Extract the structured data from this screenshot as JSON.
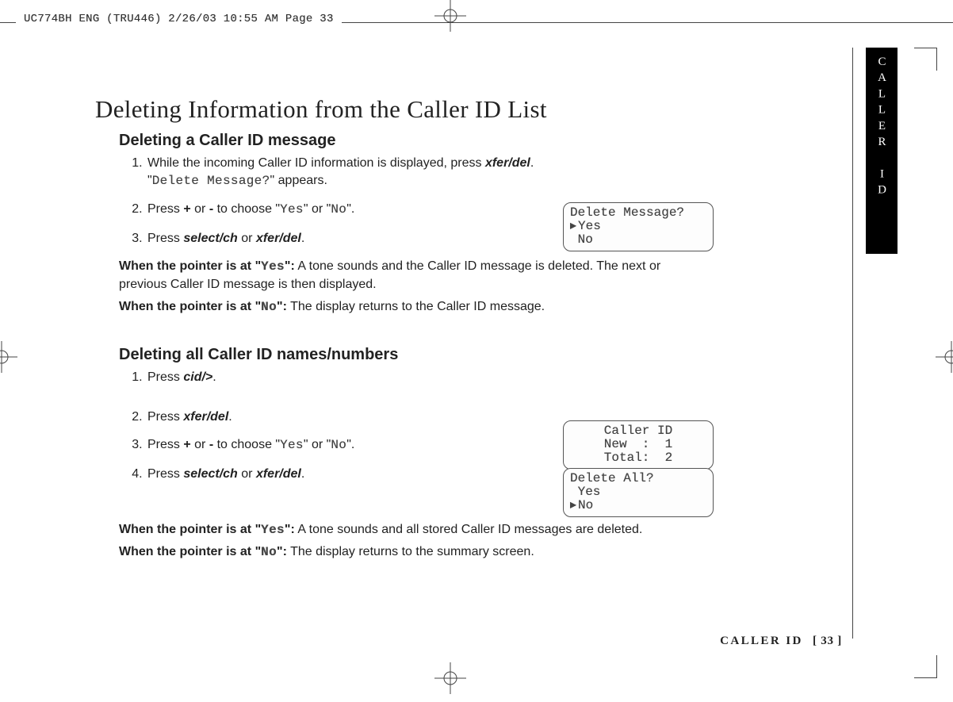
{
  "meta": {
    "slug": "UC774BH ENG (TRU446)  2/26/03  10:55 AM  Page 33"
  },
  "side_tab": "CALLER ID",
  "title": "Deleting Information from the Caller ID List",
  "section1": {
    "heading": "Deleting a Caller ID message",
    "step1_a": "While the incoming Caller ID information is displayed, press ",
    "step1_key": "xfer/del",
    "step1_b": ".",
    "step1_line2_a": "\"",
    "step1_line2_mono": "Delete Message?",
    "step1_line2_b": "\" appears.",
    "step2_a": "Press ",
    "step2_plus": "+",
    "step2_b": " or ",
    "step2_minus": "-",
    "step2_c": " to choose \"",
    "step2_yes": "Yes",
    "step2_d": "\" or \"",
    "step2_no": "No",
    "step2_e": "\".",
    "step3_a": "Press ",
    "step3_k1": "select/ch",
    "step3_b": " or ",
    "step3_k2": "xfer/del",
    "step3_c": ".",
    "exp_yes_lead_a": "When the pointer is at \"",
    "exp_yes_lead_mono": "Yes",
    "exp_yes_lead_b": "\":",
    "exp_yes_body": " A tone sounds and the Caller ID message is deleted. The next or previous Caller ID message is then displayed.",
    "exp_no_lead_a": "When the pointer is at \"",
    "exp_no_lead_mono": "No",
    "exp_no_lead_b": "\":",
    "exp_no_body": " The display returns to the Caller ID message."
  },
  "section2": {
    "heading": "Deleting all Caller ID names/numbers",
    "step1_a": "Press ",
    "step1_key": "cid/>",
    "step1_b": ".",
    "step2_a": "Press ",
    "step2_key": "xfer/del",
    "step2_b": ".",
    "step3_a": "Press ",
    "step3_plus": "+",
    "step3_b": " or ",
    "step3_minus": "-",
    "step3_c": " to choose \"",
    "step3_yes": "Yes",
    "step3_d": "\" or \"",
    "step3_no": "No",
    "step3_e": "\".",
    "step4_a": "Press ",
    "step4_k1": "select/ch",
    "step4_b": " or ",
    "step4_k2": "xfer/del",
    "step4_c": ".",
    "exp_yes_lead_a": "When the pointer is at \"",
    "exp_yes_lead_mono": "Yes",
    "exp_yes_lead_b": "\":",
    "exp_yes_body": " A tone sounds and all stored Caller ID messages are deleted.",
    "exp_no_lead_a": "When the pointer is at \"",
    "exp_no_lead_mono": "No",
    "exp_no_lead_b": "\":",
    "exp_no_body": " The display returns to the summary screen."
  },
  "lcd1": {
    "line1": "Delete Message?",
    "ptr": "▸",
    "yes": "Yes",
    "no": " No"
  },
  "lcd2": {
    "line1": "Caller ID",
    "line2": "New  :  1",
    "line3": "Total:  2"
  },
  "lcd3": {
    "line1": "Delete All?",
    "yes": " Yes",
    "ptr": "▸",
    "no": "No"
  },
  "footer": {
    "section": "CALLER ID",
    "page": "[ 33 ]"
  }
}
